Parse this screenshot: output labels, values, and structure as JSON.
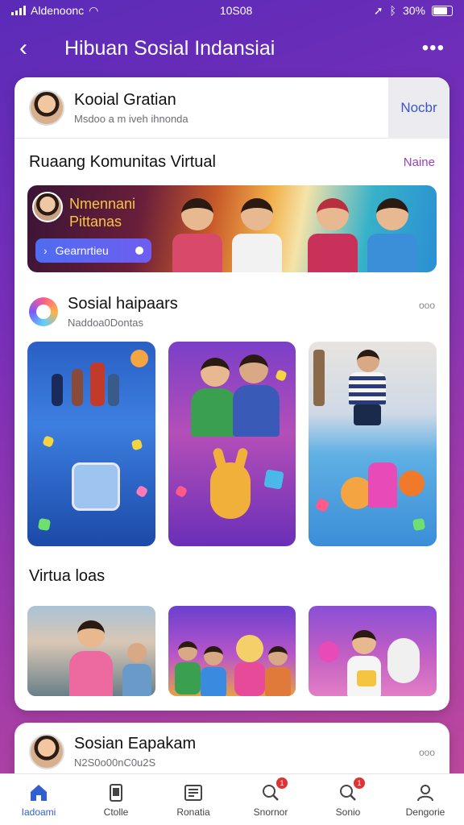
{
  "status_bar": {
    "carrier": "Aldenoonc",
    "time": "10S08",
    "battery": "30%"
  },
  "header": {
    "title": "Hibuan Sosial Indansiai"
  },
  "profile": {
    "name": "Kooial Gratian",
    "subtitle": "Msdoo a m iveh ihnonda",
    "action_label": "Nocbr"
  },
  "community": {
    "title": "Ruaang Komunitas Virtual",
    "link_label": "Naine"
  },
  "banner": {
    "title_line1": "Nmennani",
    "title_line2": "Pittanas",
    "button_label": "Gearnrtieu"
  },
  "group": {
    "name": "Sosial haipaars",
    "subtitle": "Naddoa0Dontas",
    "more": "ooo"
  },
  "virtual": {
    "title": "Virtua loas"
  },
  "second_post": {
    "name": "Sosian Eapakam",
    "subtitle": "N2S0o00nC0u2S",
    "more": "ooo"
  },
  "nav": {
    "items": [
      {
        "label": "Iadoami",
        "icon": "home-icon",
        "active": true
      },
      {
        "label": "Ctolle",
        "icon": "phone-icon"
      },
      {
        "label": "Ronatia",
        "icon": "news-icon"
      },
      {
        "label": "Snornor",
        "icon": "search-icon",
        "badge": "1"
      },
      {
        "label": "Sonio",
        "icon": "search-icon",
        "badge": "1"
      },
      {
        "label": "Dengorie",
        "icon": "profile-icon"
      }
    ]
  },
  "colors": {
    "accent": "#2f5fd0",
    "link": "#9a3fc0",
    "background_start": "#5a2bb8",
    "background_end": "#c24a9c"
  }
}
